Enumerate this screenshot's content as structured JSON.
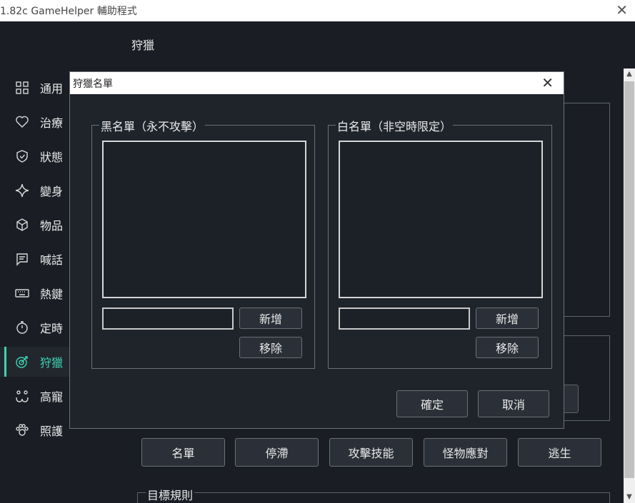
{
  "window": {
    "title": "1.82c GameHelper 輔助程式",
    "close_glyph": "✕"
  },
  "page": {
    "header": "狩獵"
  },
  "sidebar": {
    "items": [
      {
        "label": "通用",
        "icon": "grid-icon"
      },
      {
        "label": "治療",
        "icon": "heart-icon"
      },
      {
        "label": "狀態",
        "icon": "shield-icon"
      },
      {
        "label": "變身",
        "icon": "sparkle-icon"
      },
      {
        "label": "物品",
        "icon": "cube-icon"
      },
      {
        "label": "喊話",
        "icon": "chat-icon"
      },
      {
        "label": "熱鍵",
        "icon": "keyboard-icon"
      },
      {
        "label": "定時",
        "icon": "stopwatch-icon"
      },
      {
        "label": "狩獵",
        "icon": "target-icon",
        "active": true
      },
      {
        "label": "高寵",
        "icon": "pet-face-icon"
      },
      {
        "label": "照護",
        "icon": "paw-icon"
      }
    ],
    "accent": "#3fd4b4"
  },
  "bottom_buttons": [
    "名單",
    "停滯",
    "攻擊技能",
    "怪物應對",
    "逃生"
  ],
  "target_rules_label": "目標規則",
  "dialog": {
    "title": "狩獵名單",
    "close_glyph": "✕",
    "blacklist": {
      "legend": "黑名單（永不攻擊）",
      "add_label": "新增",
      "remove_label": "移除",
      "input_value": ""
    },
    "whitelist": {
      "legend": "白名單（非空時限定）",
      "add_label": "新增",
      "remove_label": "移除",
      "input_value": ""
    },
    "ok_label": "確定",
    "cancel_label": "取消"
  },
  "scrollbar": {
    "up": "▲",
    "down": "▼"
  }
}
